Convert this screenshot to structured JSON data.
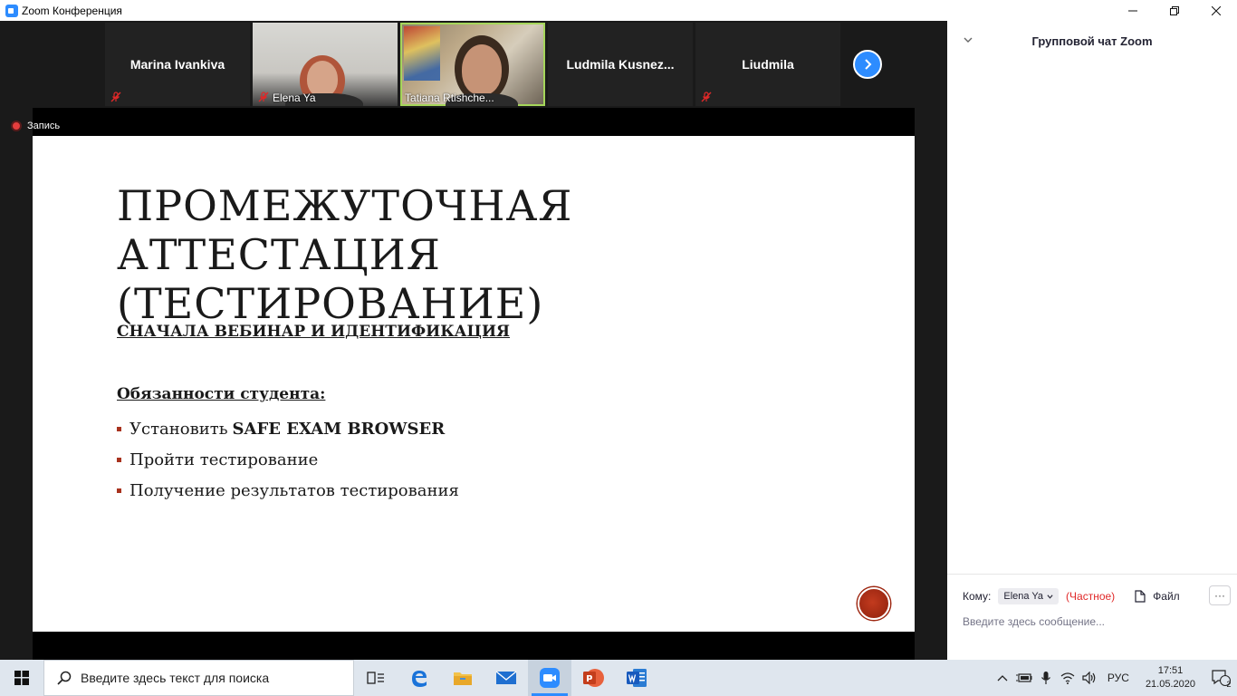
{
  "window": {
    "title": "Zoom Конференция",
    "minimize": "—",
    "restore": "❐",
    "close": "✕"
  },
  "participants": [
    {
      "name": "Marina Ivankiva",
      "muted": true,
      "video": false
    },
    {
      "name": "Elena Ya",
      "muted": true,
      "video": true
    },
    {
      "name": "Tatiana Rtishche...",
      "muted": false,
      "video": true,
      "active_speaker": true
    },
    {
      "name": "Ludmila  Kusnez...",
      "muted": false,
      "video": false
    },
    {
      "name": "Liudmila",
      "muted": true,
      "video": false
    }
  ],
  "recording": {
    "label": "Запись"
  },
  "slide": {
    "title_line1": "ПРОМЕЖУТОЧНАЯ АТТЕСТАЦИЯ",
    "title_line2": "(ТЕСТИРОВАНИЕ)",
    "subtitle": "СНАЧАЛА ВЕБИНАР И ИДЕНТИФИКАЦИЯ",
    "heading": "Обязанности студента:",
    "bullets": [
      {
        "text": "Установить",
        "bold": "SAFE EXAM BROWSER"
      },
      {
        "text": "Пройти тестирование",
        "bold": ""
      },
      {
        "text": "Получение результатов тестирования",
        "bold": ""
      }
    ]
  },
  "chat": {
    "title": "Групповой чат Zoom",
    "to_label": "Кому:",
    "recipient": "Elena Ya",
    "private_label": "(Частное)",
    "file_label": "Файл",
    "more_label": "···",
    "input_placeholder": "Введите здесь сообщение..."
  },
  "taskbar": {
    "search_placeholder": "Введите здесь текст для поиска",
    "lang": "РУС",
    "time": "17:51",
    "date": "21.05.2020",
    "notifications": "2"
  },
  "colors": {
    "accent": "#2d8cff",
    "muted_red": "#e02828",
    "slide_bullet": "#a8321e"
  }
}
